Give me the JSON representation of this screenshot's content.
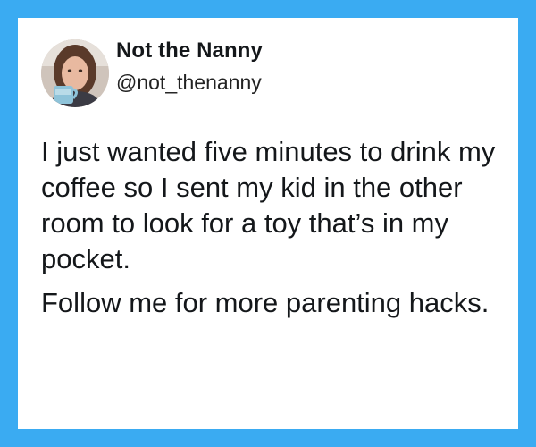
{
  "tweet": {
    "display_name": "Not the Nanny",
    "handle": "@not_thenanny",
    "paragraphs": [
      "I just wanted five minutes to drink my coffee so I sent my kid in the other room to look for a toy that’s in my pocket.",
      "Follow me for more parenting hacks."
    ]
  },
  "colors": {
    "frame_background": "#3aabf2",
    "card_background": "#ffffff",
    "text": "#14171a"
  },
  "icons": {
    "avatar": "profile-photo-woman-with-mug"
  }
}
